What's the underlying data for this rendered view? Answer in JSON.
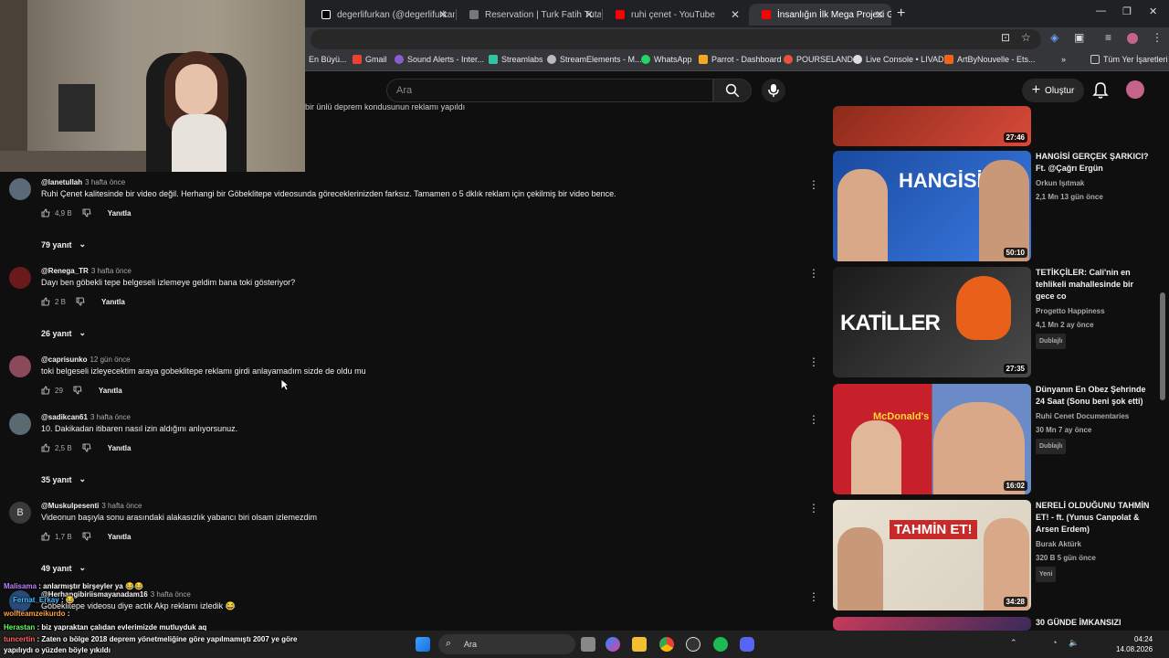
{
  "browser": {
    "tabs": [
      {
        "label": "degerlifurkan (@degerlifurkan)",
        "color": "#000000"
      },
      {
        "label": "Reservation | Turk Fatih Tutak",
        "color": "#444444"
      },
      {
        "label": "ruhi çenet - YouTube",
        "color": "#ff0000"
      },
      {
        "label": "İnsanlığın İlk Mega Projesi Göb",
        "color": "#ff0000"
      }
    ],
    "bookmarks": [
      {
        "label": "En Büyü...",
        "color": "#d04040"
      },
      {
        "label": "Gmail",
        "color": "#ea4335"
      },
      {
        "label": "Sound Alerts - Inter...",
        "color": "#8a5cd1"
      },
      {
        "label": "Streamlabs",
        "color": "#31c3a2"
      },
      {
        "label": "StreamElements - M...",
        "color": "#cccccc"
      },
      {
        "label": "WhatsApp",
        "color": "#25d366"
      },
      {
        "label": "Parrot - Dashboard",
        "color": "#f5a623"
      },
      {
        "label": "POURSELAND",
        "color": "#e8543a"
      },
      {
        "label": "Live Console • LIVAD",
        "color": "#dddddd"
      },
      {
        "label": "ArtByNouvelle - Ets...",
        "color": "#f1641e"
      },
      {
        "label": "Tüm Yer İşaretleri",
        "color": "#aaaaaa"
      }
    ]
  },
  "youtube": {
    "search_placeholder": "Ara",
    "create_label": "Oluştur",
    "partial_comment": "bir ünlü deprem kondusunun reklamı yapıldı",
    "comments": [
      {
        "author": "@lanetullah",
        "time": "3 hafta önce",
        "text": "Ruhi Çenet kalitesinde bir video değil. Herhangi bir Göbeklitepe videosunda göreceklerinizden farksız. Tamamen o 5 dklık reklam için çekilmiş bir video bence.",
        "likes": "4,9 B",
        "reply_label": "Yanıtla",
        "replies": "79 yanıt",
        "avatar_color": "#5a6a7a"
      },
      {
        "author": "@Renega_TR",
        "time": "3 hafta önce",
        "text": "Dayı ben göbekli tepe belgeseli izlemeye geldim bana toki gösteriyor?",
        "likes": "2 B",
        "reply_label": "Yanıtla",
        "replies": "26 yanıt",
        "avatar_color": "#6a1a1a"
      },
      {
        "author": "@caprisunko",
        "time": "12 gün önce",
        "text": "toki belgeseli izleyecektim araya gobeklitepe reklamı girdi anlayamadım sizde de oldu mu",
        "likes": "29",
        "reply_label": "Yanıtla",
        "replies": "",
        "avatar_color": "#8a4a5a"
      },
      {
        "author": "@sadikcan61",
        "time": "3 hafta önce",
        "text": "10. Dakikadan itibaren nasıl izin aldığını anlıyorsunuz.",
        "likes": "2,5 B",
        "reply_label": "Yanıtla",
        "replies": "35 yanıt",
        "avatar_color": "#5a6a70"
      },
      {
        "author": "@Muskulpesenti",
        "time": "3 hafta önce",
        "text": "Videonun başıyla sonu arasındaki alakasızlık yabancı biri olsam izlemezdim",
        "likes": "1,7 B",
        "reply_label": "Yanıtla",
        "replies": "49 yanıt",
        "avatar_color": "#3a3a3a",
        "avatar_letter": "B"
      },
      {
        "author": "@Herhangibiriismayanadam16",
        "time": "3 hafta önce",
        "text": "Göbeklitepe videosu diye actık Akp reklamı izledik 😂",
        "likes": "",
        "reply_label": "",
        "replies": "",
        "avatar_color": "#2a4a7a"
      }
    ],
    "recommendations": [
      {
        "title": "",
        "channel": "",
        "meta": "",
        "duration": "27:46",
        "badge": "",
        "colors": [
          "#8b2a1a",
          "#d84a3a"
        ]
      },
      {
        "title": "HANGİSİ GERÇEK ŞARKICI? Ft. @Çağrı Ergün",
        "channel": "Orkun Işıtmak",
        "meta": "2,1 Mn   13 gün önce",
        "duration": "50:10",
        "badge": "",
        "thumb_text": "HANGİSİ",
        "colors": [
          "#1a4aa0",
          "#3a7ae0"
        ]
      },
      {
        "title": "TETİKÇİLER: Cali'nin en tehlikeli mahallesinde bir gece co",
        "channel": "Progetto Happiness",
        "meta": "4,1 Mn   2 ay önce",
        "duration": "27:35",
        "badge": "Dublajlı",
        "thumb_text": "KATİLLER",
        "colors": [
          "#1a1a1a",
          "#4a4a4a"
        ]
      },
      {
        "title": "Dünyanın En Obez Şehrinde 24 Saat (Sonu beni şok etti)",
        "channel": "Ruhi Cenet Documentaries",
        "meta": "30 Mn   7 ay önce",
        "duration": "16:02",
        "badge": "Dublajlı",
        "thumb_text": "McDonald's",
        "colors": [
          "#c8202a",
          "#6a8ac8"
        ]
      },
      {
        "title": "NERELİ OLDUĞUNU TAHMİN ET! - ft. (Yunus Canpolat & Arsen Erdem)",
        "channel": "Burak Aktürk",
        "meta": "320 B   5 gün önce",
        "duration": "34:28",
        "badge": "Yeni",
        "thumb_text": "TAHMİN ET!",
        "colors": [
          "#e8e0d0",
          "#c82a2a"
        ]
      },
      {
        "title": "30 GÜNDE İMKANSIZI",
        "channel": "",
        "meta": "",
        "duration": "",
        "badge": "",
        "colors": [
          "#c83a5a",
          "#3a2a5a"
        ]
      }
    ]
  },
  "chat": [
    {
      "user": "Malisama",
      "text": ": anlarmıştır birşeyler ya 😂😂",
      "color": "#c080ff"
    },
    {
      "user": "Fernat_Erkay",
      "text": ": 😂",
      "color": "#40c0ff"
    },
    {
      "user": "wolfteamzeikurdo",
      "text": ":",
      "color": "#ffa040"
    },
    {
      "user": "Herastan",
      "text": ": biz yapraktan çalıdan evlerimizde mutluyduk aq",
      "color": "#60ff60"
    },
    {
      "user": "tuncertin",
      "text": ": Zaten o bölge 2018 deprem yönetmeliğine göre yapılmamıştı 2007 ye göre",
      "color": "#ff6060"
    },
    {
      "user": "",
      "text": "yapılıydı o yüzden böyle yıkıldı",
      "color": "#ffffff"
    }
  ],
  "taskbar": {
    "search_label": "Ara",
    "time": "04:24",
    "date": "14.08.2026"
  }
}
